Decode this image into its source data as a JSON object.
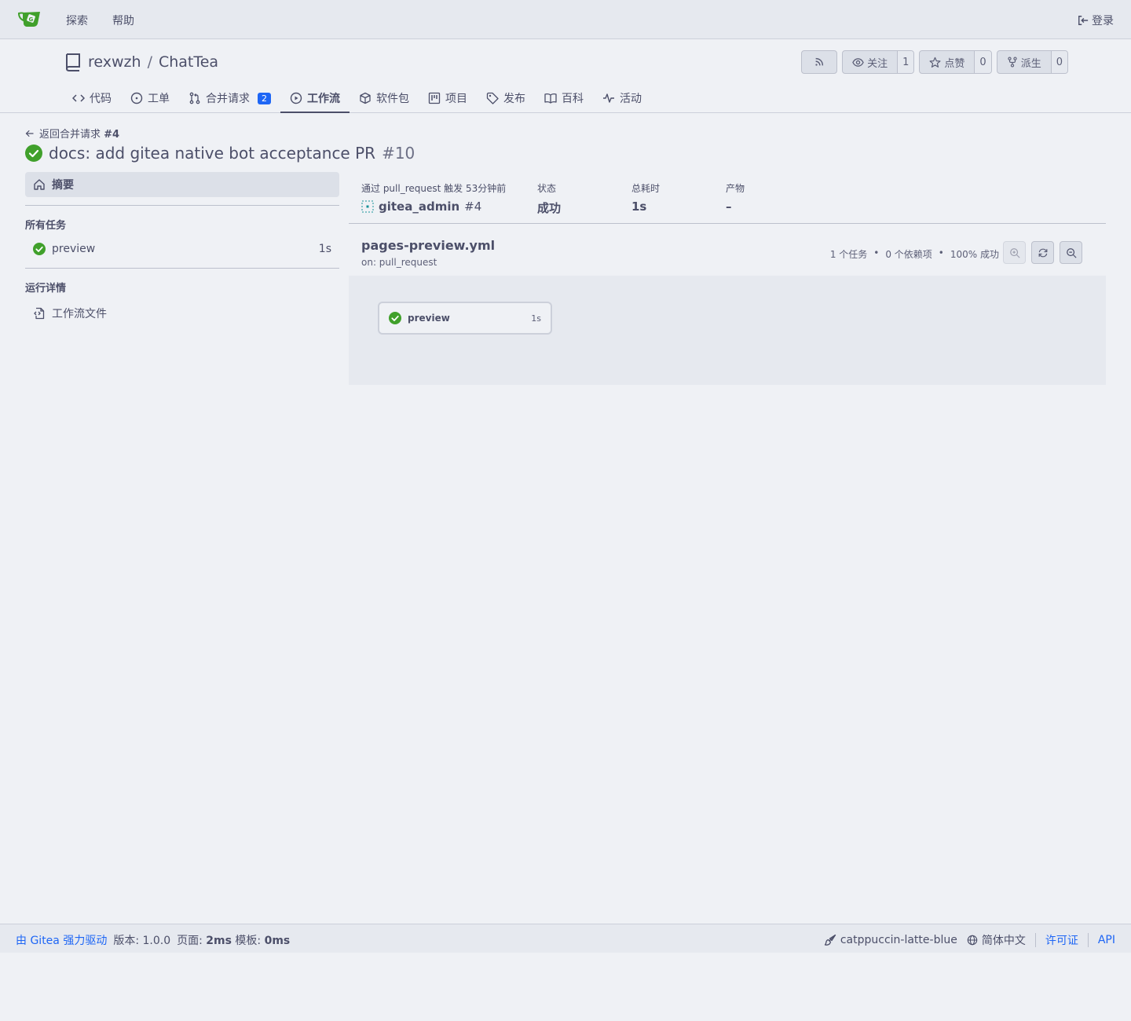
{
  "nav": {
    "explore": "探索",
    "help": "帮助",
    "login": "登录"
  },
  "repo": {
    "owner": "rexwzh",
    "separator": "/",
    "name": "ChatTea",
    "watch_label": "关注",
    "watch_count": "1",
    "star_label": "点赞",
    "star_count": "0",
    "fork_label": "派生",
    "fork_count": "0"
  },
  "tabs": {
    "code": "代码",
    "issues": "工单",
    "pulls": "合并请求",
    "pulls_count": "2",
    "actions": "工作流",
    "packages": "软件包",
    "projects": "项目",
    "releases": "发布",
    "wiki": "百科",
    "activity": "活动"
  },
  "run": {
    "back_label": "返回合并请求",
    "back_ref": "#4",
    "title": "docs: add gitea native bot acceptance PR",
    "number": "#10"
  },
  "sidebar": {
    "summary": "摘要",
    "all_jobs_heading": "所有任务",
    "jobs": [
      {
        "name": "preview",
        "duration": "1s"
      }
    ],
    "run_details_heading": "运行详情",
    "workflow_file": "工作流文件"
  },
  "summary": {
    "trigger_label": "通过 pull_request 触发 53分钟前",
    "trigger_user": "gitea_admin",
    "trigger_ref": "#4",
    "status_label": "状态",
    "status_value": "成功",
    "duration_label": "总耗时",
    "duration_value": "1s",
    "artifacts_label": "产物",
    "artifacts_value": "–"
  },
  "workflow": {
    "name": "pages-preview.yml",
    "on": "on: pull_request",
    "stat_jobs": "1 个任务",
    "stat_deps": "0 个依赖项",
    "stat_success": "100% 成功",
    "bullet": "•",
    "graph_job": {
      "name": "preview",
      "duration": "1s"
    }
  },
  "footer": {
    "powered_by": "由 Gitea 强力驱动",
    "version": "版本: 1.0.0",
    "page_label": "页面:",
    "page_time": "2ms",
    "template_label": "模板:",
    "template_time": "0ms",
    "theme": "catppuccin-latte-blue",
    "language": "简体中文",
    "license": "许可证",
    "api": "API"
  },
  "colors": {
    "success": "#40a02b",
    "link": "#1e66f5",
    "background": "#eff1f5"
  }
}
